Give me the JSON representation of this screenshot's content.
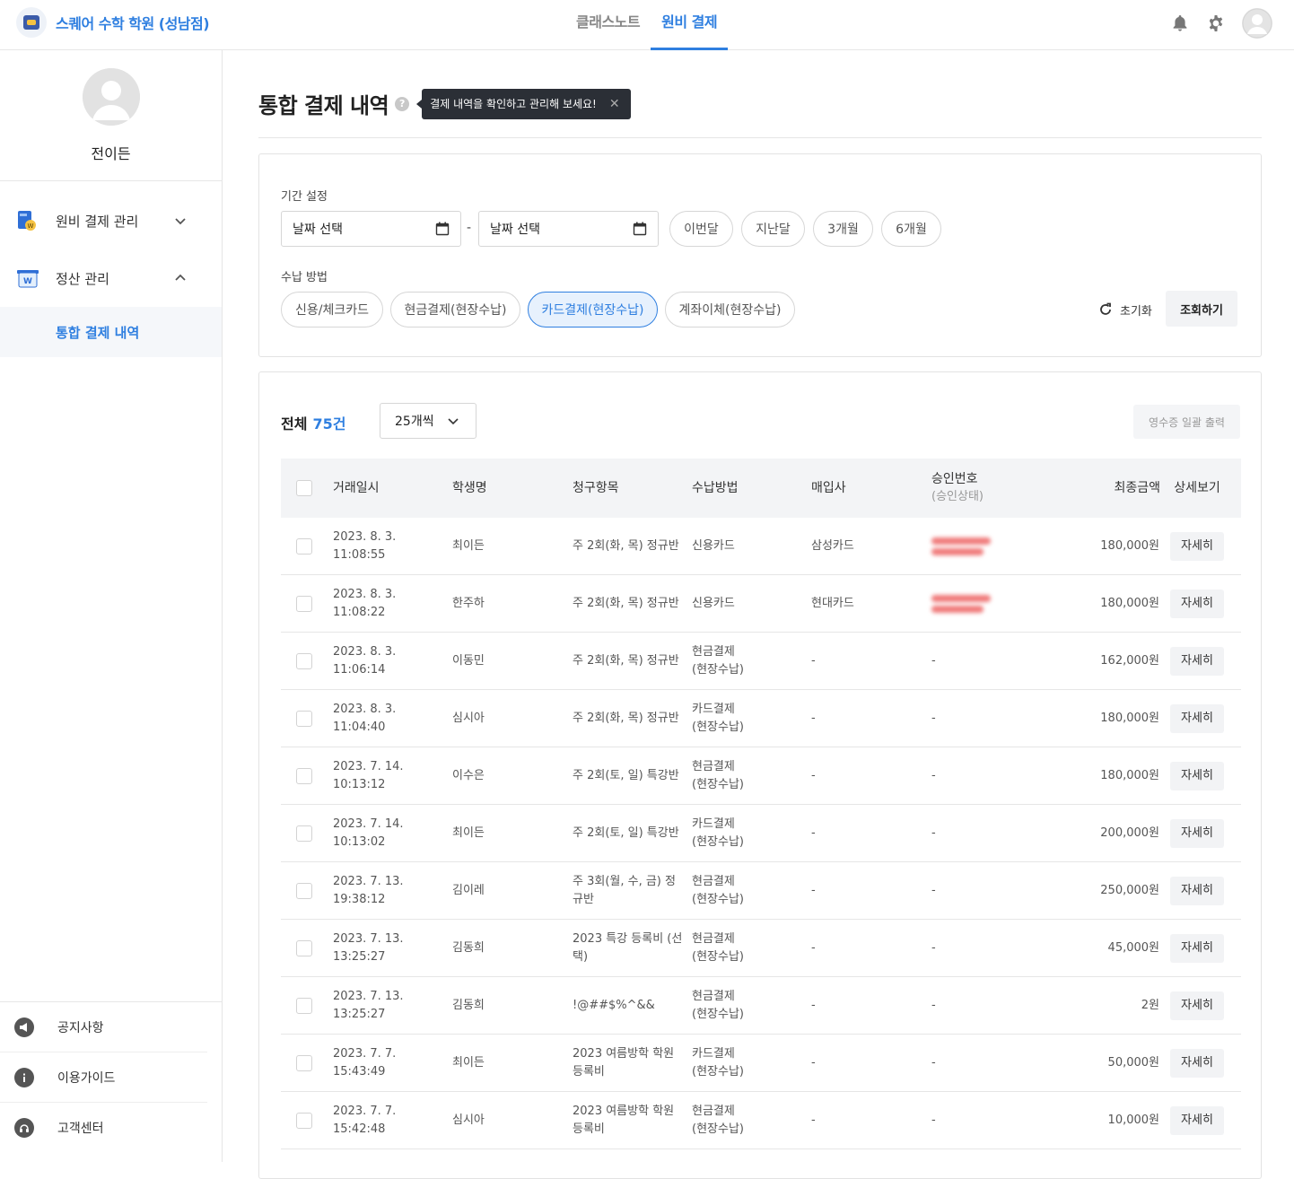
{
  "header": {
    "brand_name": "스퀘어 수학 학원 (성남점)",
    "tabs": [
      {
        "label": "클래스노트",
        "active": false
      },
      {
        "label": "원비 결제",
        "active": true
      }
    ],
    "icons": [
      "bell-icon",
      "gear-icon",
      "user-avatar"
    ],
    "accent_color": "#2f7fe0"
  },
  "sidebar": {
    "profile_name": "전이든",
    "items": [
      {
        "label": "원비 결제 관리",
        "icon": "payment-card-icon",
        "expanded": false
      },
      {
        "label": "정산 관리",
        "icon": "settlement-won-icon",
        "expanded": true
      }
    ],
    "sub_item": "통합 결제 내역",
    "bottom": [
      {
        "label": "공지사항",
        "icon": "megaphone-icon"
      },
      {
        "label": "이용가이드",
        "icon": "info-icon"
      },
      {
        "label": "고객센터",
        "icon": "headset-icon"
      }
    ]
  },
  "page": {
    "title": "통합 결제 내역",
    "tooltip": "결제 내역을 확인하고 관리해 보세요!"
  },
  "filters": {
    "period_label": "기간 설정",
    "date_start_placeholder": "날짜 선택",
    "date_end_placeholder": "날짜 선택",
    "date_separator": "-",
    "period_buttons": [
      "이번달",
      "지난달",
      "3개월",
      "6개월"
    ],
    "method_label": "수납 방법",
    "methods": [
      {
        "label": "신용/체크카드",
        "active": false
      },
      {
        "label": "현금결제(현장수납)",
        "active": false
      },
      {
        "label": "카드결제(현장수납)",
        "active": true
      },
      {
        "label": "계좌이체(현장수납)",
        "active": false
      }
    ],
    "reset_label": "초기화",
    "search_label": "조회하기"
  },
  "table": {
    "total_label": "전체",
    "total_count": "75건",
    "per_page": "25개씩",
    "receipt_button": "영수증 일괄 출력",
    "columns": {
      "date": "거래일시",
      "student": "학생명",
      "item": "청구항목",
      "method": "수납방법",
      "acquirer": "매입사",
      "approval": "승인번호",
      "approval_sub": "(승인상태)",
      "amount": "최종금액",
      "detail": "상세보기"
    },
    "detail_label": "자세히",
    "rows": [
      {
        "date": "2023. 8. 3.",
        "time": "11:08:55",
        "student": "최이든",
        "item": "주 2회(화, 목) 정규반",
        "method": "신용카드",
        "method2": "",
        "acquirer": "삼성카드",
        "approval": "blurred",
        "amount": "180,000원"
      },
      {
        "date": "2023. 8. 3.",
        "time": "11:08:22",
        "student": "한주하",
        "item": "주 2회(화, 목) 정규반",
        "method": "신용카드",
        "method2": "",
        "acquirer": "현대카드",
        "approval": "blurred",
        "amount": "180,000원"
      },
      {
        "date": "2023. 8. 3.",
        "time": "11:06:14",
        "student": "이동민",
        "item": "주 2회(화, 목) 정규반",
        "method": "현금결제",
        "method2": "(현장수납)",
        "acquirer": "-",
        "approval": "-",
        "amount": "162,000원"
      },
      {
        "date": "2023. 8. 3.",
        "time": "11:04:40",
        "student": "심시아",
        "item": "주 2회(화, 목) 정규반",
        "method": "카드결제",
        "method2": "(현장수납)",
        "acquirer": "-",
        "approval": "-",
        "amount": "180,000원"
      },
      {
        "date": "2023. 7. 14.",
        "time": "10:13:12",
        "student": "이수은",
        "item": "주 2회(토, 일) 특강반",
        "method": "현금결제",
        "method2": "(현장수납)",
        "acquirer": "-",
        "approval": "-",
        "amount": "180,000원"
      },
      {
        "date": "2023. 7. 14.",
        "time": "10:13:02",
        "student": "최이든",
        "item": "주 2회(토, 일) 특강반",
        "method": "카드결제",
        "method2": "(현장수납)",
        "acquirer": "-",
        "approval": "-",
        "amount": "200,000원"
      },
      {
        "date": "2023. 7. 13.",
        "time": "19:38:12",
        "student": "김이레",
        "item": "주 3회(월, 수, 금) 정규반",
        "method": "현금결제",
        "method2": "(현장수납)",
        "acquirer": "-",
        "approval": "-",
        "amount": "250,000원"
      },
      {
        "date": "2023. 7. 13.",
        "time": "13:25:27",
        "student": "김동희",
        "item": "2023 특강 등록비 (선택)",
        "method": "현금결제",
        "method2": "(현장수납)",
        "acquirer": "-",
        "approval": "-",
        "amount": "45,000원"
      },
      {
        "date": "2023. 7. 13.",
        "time": "13:25:27",
        "student": "김동희",
        "item": "!@##$%^&&",
        "method": "현금결제",
        "method2": "(현장수납)",
        "acquirer": "-",
        "approval": "-",
        "amount": "2원"
      },
      {
        "date": "2023. 7. 7.",
        "time": "15:43:49",
        "student": "최이든",
        "item": "2023 여름방학 학원 등록비",
        "method": "카드결제",
        "method2": "(현장수납)",
        "acquirer": "-",
        "approval": "-",
        "amount": "50,000원"
      },
      {
        "date": "2023. 7. 7.",
        "time": "15:42:48",
        "student": "심시아",
        "item": "2023 여름방학 학원 등록비",
        "method": "현금결제",
        "method2": "(현장수납)",
        "acquirer": "-",
        "approval": "-",
        "amount": "10,000원"
      }
    ]
  }
}
